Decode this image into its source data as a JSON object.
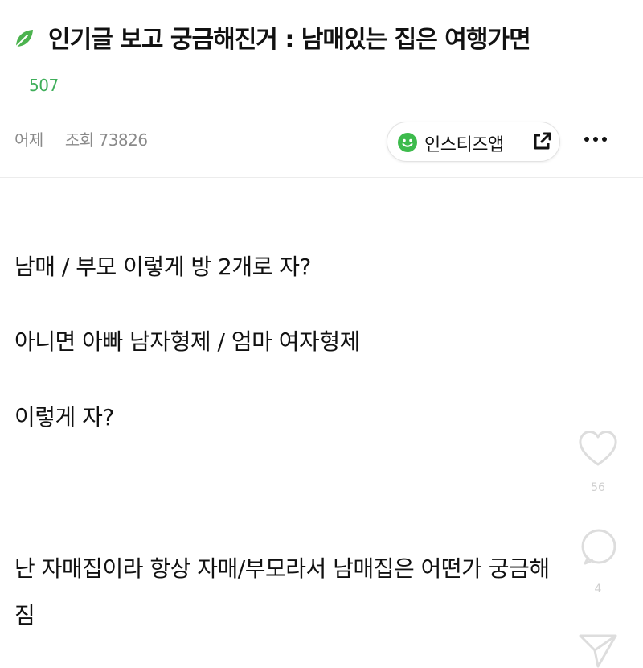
{
  "post": {
    "title": "인기글 보고 궁금해진거 : 남매있는 집은 여행가면",
    "score": "507",
    "date": "어제",
    "views": "조회 73826",
    "app_button_label": "인스티즈앱",
    "body": [
      "남매 / 부모 이렇게 방 2개로 자?",
      "아니면 아빠 남자형제 / 엄마 여자형제",
      "이렇게 자?",
      "난 자매집이라 항상 자매/부모라서 남매집은 어떤가 궁금해",
      "짐"
    ]
  },
  "actions": {
    "like_count": "56",
    "comment_count": "4"
  },
  "icons": {
    "leaf": "leaf-icon",
    "smile": "smile-icon",
    "external": "external-link-icon",
    "more": "more-icon",
    "heart": "heart-icon",
    "comment": "comment-icon",
    "share": "share-icon"
  },
  "colors": {
    "accent_green": "#3fae5a",
    "meta_gray": "#8a8a8a",
    "text": "#111111"
  }
}
